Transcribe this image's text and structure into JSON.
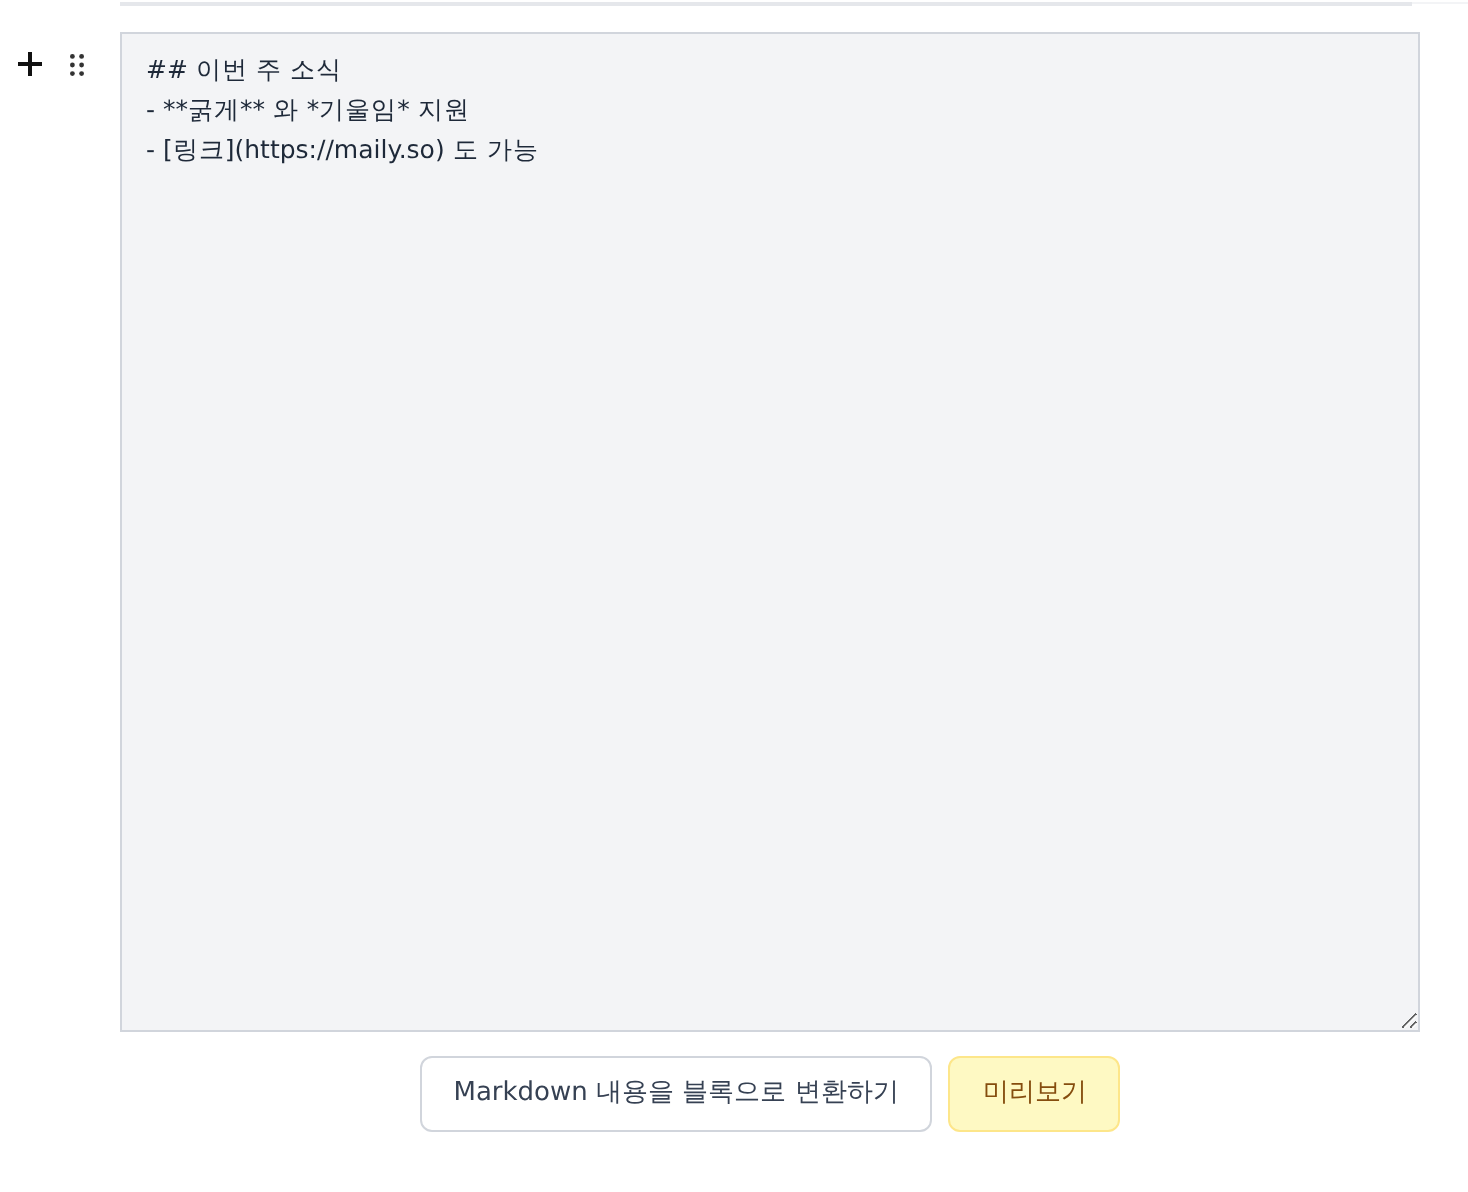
{
  "editor": {
    "value": "## 이번 주 소식\n- **굵게** 와 *기울임* 지원\n- [링크](https://maily.so) 도 가능"
  },
  "buttons": [
    {
      "label": "Markdown 내용을 블록으로 변환하기",
      "kind": "secondary"
    },
    {
      "label": "미리보기",
      "kind": "highlight"
    }
  ]
}
